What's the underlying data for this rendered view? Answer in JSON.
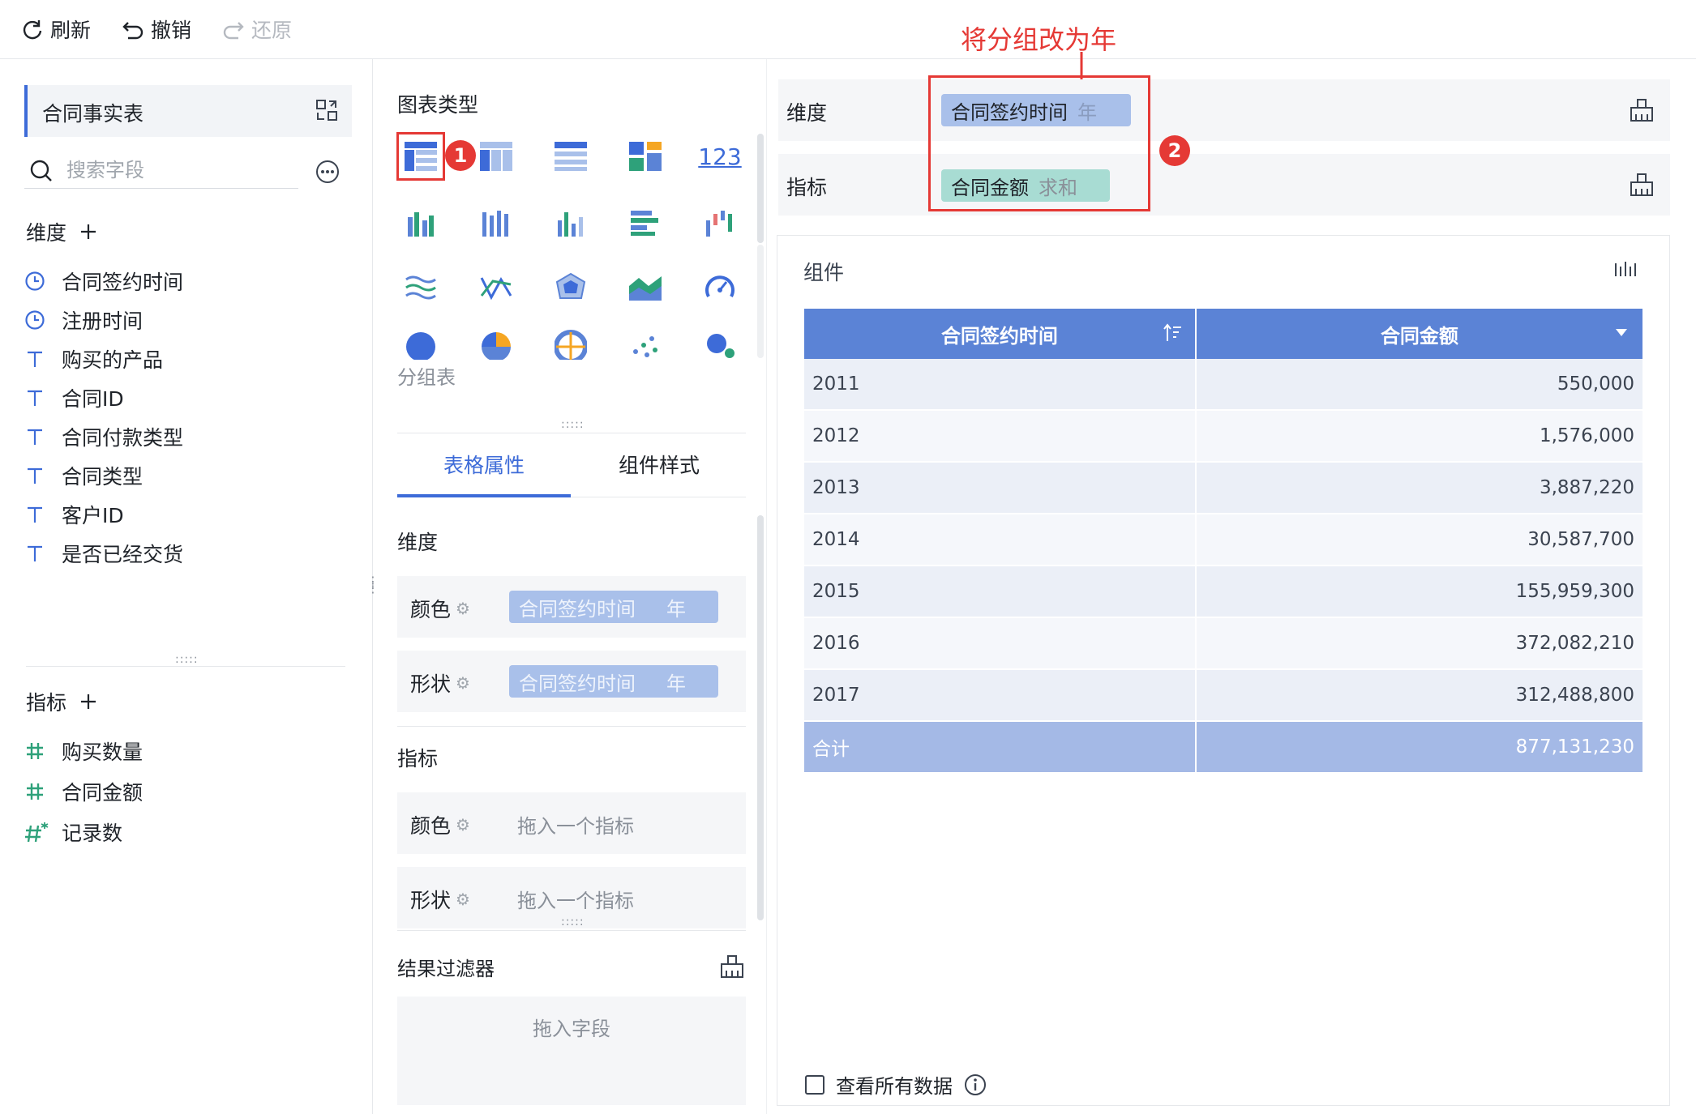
{
  "toolbar": {
    "refresh": "刷新",
    "undo": "撤销",
    "redo": "还原"
  },
  "left": {
    "table_name": "合同事实表",
    "search_placeholder": "搜索字段",
    "dimension_title": "维度",
    "dimensions": [
      {
        "icon": "clock-icon",
        "label": "合同签约时间"
      },
      {
        "icon": "clock-icon",
        "label": "注册时间"
      },
      {
        "icon": "text-type-icon",
        "label": "购买的产品"
      },
      {
        "icon": "text-type-icon",
        "label": "合同ID"
      },
      {
        "icon": "text-type-icon",
        "label": "合同付款类型"
      },
      {
        "icon": "text-type-icon",
        "label": "合同类型"
      },
      {
        "icon": "text-type-icon",
        "label": "客户ID"
      },
      {
        "icon": "text-type-icon",
        "label": "是否已经交货"
      }
    ],
    "metric_title": "指标",
    "metrics": [
      {
        "icon": "hash-icon",
        "label": "购买数量"
      },
      {
        "icon": "hash-icon",
        "label": "合同金额"
      },
      {
        "icon": "hash-star-icon",
        "label": "记录数"
      }
    ]
  },
  "middle": {
    "chart_type_title": "图表类型",
    "chart_type_tooltip": "分组表",
    "numeric_icon_text": "123",
    "tabs": [
      "表格属性",
      "组件样式"
    ],
    "dimension_title": "维度",
    "metric_title": "指标",
    "color_label": "颜色",
    "shape_label": "形状",
    "dim_color_field": "合同签约时间",
    "dim_color_agg": "年",
    "dim_shape_field": "合同签约时间",
    "dim_shape_agg": "年",
    "drop_metric_placeholder": "拖入一个指标",
    "filter_title": "结果过滤器",
    "drop_field_placeholder": "拖入字段"
  },
  "right": {
    "dimension_label": "维度",
    "dimension_chip": {
      "field": "合同签约时间",
      "agg": "年"
    },
    "metric_label": "指标",
    "metric_chip": {
      "field": "合同金额",
      "agg": "求和"
    },
    "annotation_text": "将分组改为年",
    "badge1": "1",
    "badge2": "2",
    "component_title": "组件",
    "table": {
      "headers": [
        "合同签约时间",
        "合同金额"
      ],
      "rows": [
        [
          "2011",
          "550,000"
        ],
        [
          "2012",
          "1,576,000"
        ],
        [
          "2013",
          "3,887,220"
        ],
        [
          "2014",
          "30,587,700"
        ],
        [
          "2015",
          "155,959,300"
        ],
        [
          "2016",
          "372,082,210"
        ],
        [
          "2017",
          "312,488,800"
        ]
      ],
      "total": [
        "合计",
        "877,131,230"
      ]
    },
    "view_all_label": "查看所有数据"
  },
  "colors": {
    "accent": "#3d6bd8",
    "header": "#5b83d6",
    "total": "#a4b9e6",
    "annotation": "#e53935",
    "metric_chip": "#a8dcd3",
    "dim_chip": "#a9c0ea"
  }
}
